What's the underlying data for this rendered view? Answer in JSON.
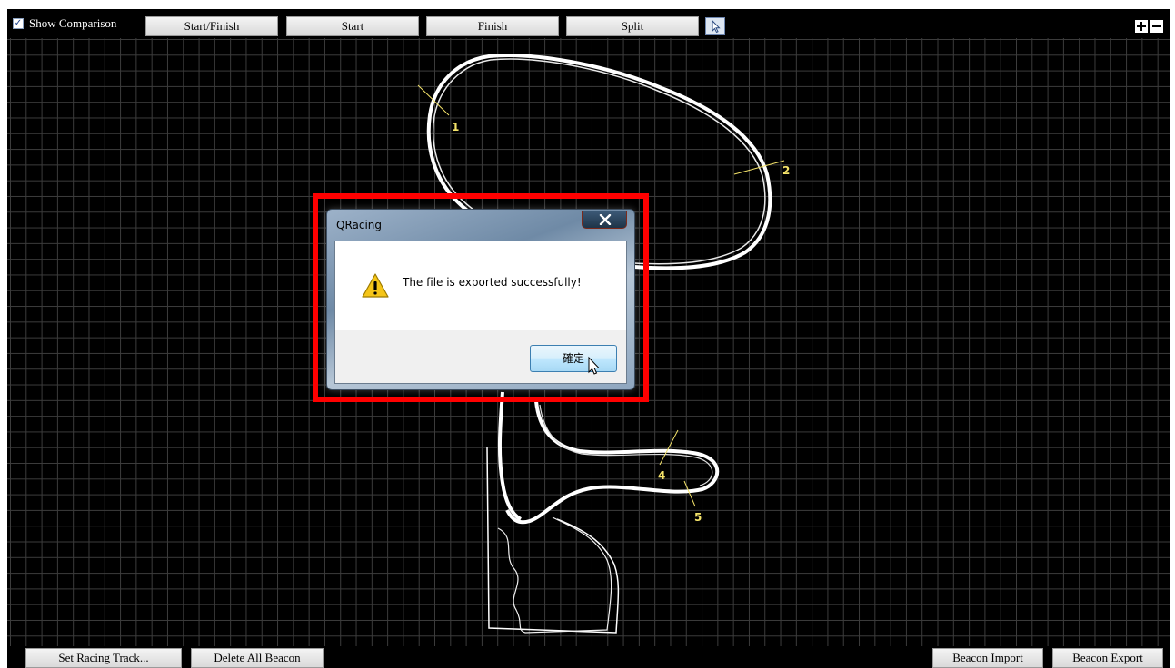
{
  "toolbar": {
    "show_comparison_label": "Show Comparison",
    "show_comparison_checked": true,
    "buttons": [
      "Start/Finish",
      "Start",
      "Finish",
      "Split"
    ],
    "pointer_tool_icon": "arrow-cursor-icon",
    "zoom_in_icon": "plus-icon",
    "zoom_out_icon": "minus-icon"
  },
  "track": {
    "beacon_labels": [
      "1",
      "2",
      "4",
      "5"
    ],
    "line_color": "#ffffff",
    "label_color": "#f4e36a",
    "grid_color": "#3c3c3c"
  },
  "bottombar": {
    "set_racing_track": "Set Racing Track...",
    "delete_all_beacon": "Delete All Beacon",
    "beacon_import": "Beacon Import",
    "beacon_export": "Beacon Export"
  },
  "dialog": {
    "title": "QRacing",
    "message": "The file is exported successfully!",
    "ok_label": "確定",
    "icon": "warning-icon",
    "close_icon": "close-icon",
    "highlight_color": "#ff0000"
  }
}
